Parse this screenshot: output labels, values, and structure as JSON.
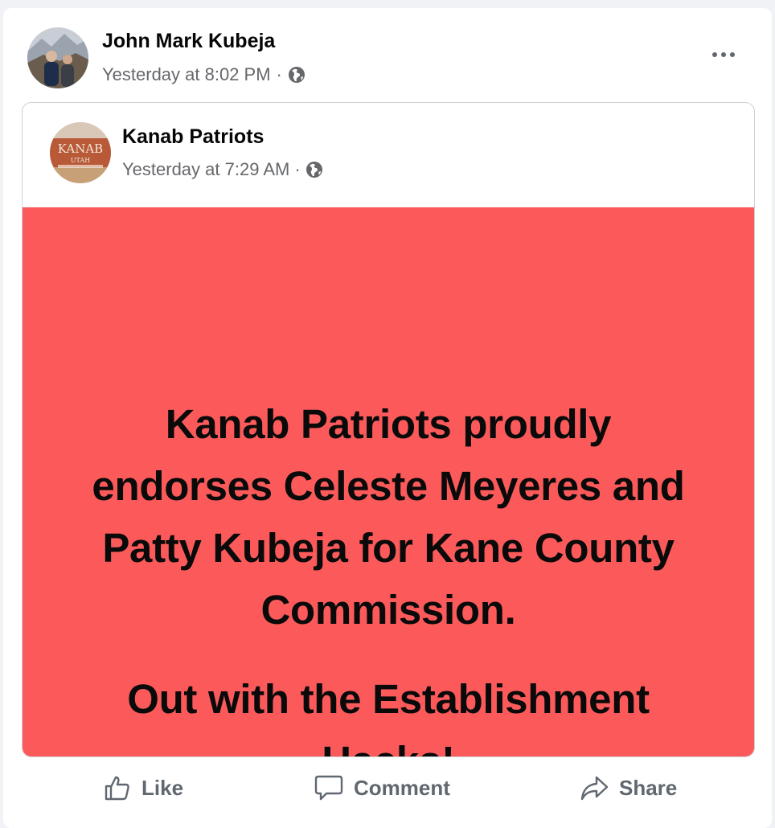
{
  "post": {
    "author": "John Mark Kubeja",
    "timestamp": "Yesterday at 8:02 PM",
    "separator": "·",
    "privacy_icon": "globe-icon",
    "more_icon": "more-options-icon"
  },
  "shared_post": {
    "page_name": "Kanab Patriots",
    "timestamp": "Yesterday at 7:29 AM",
    "separator": "·",
    "privacy_icon": "globe-icon",
    "avatar_sign": {
      "title": "KANAB",
      "subtitle": "UTAH"
    },
    "image": {
      "background_color": "#fc5a5a",
      "paragraph_1": "Kanab Patriots proudly endorses Celeste Meyeres and Patty Kubeja for Kane County Commission.",
      "paragraph_2": "Out with the Establishment Hacks!"
    }
  },
  "actions": {
    "like": "Like",
    "comment": "Comment",
    "share": "Share"
  }
}
